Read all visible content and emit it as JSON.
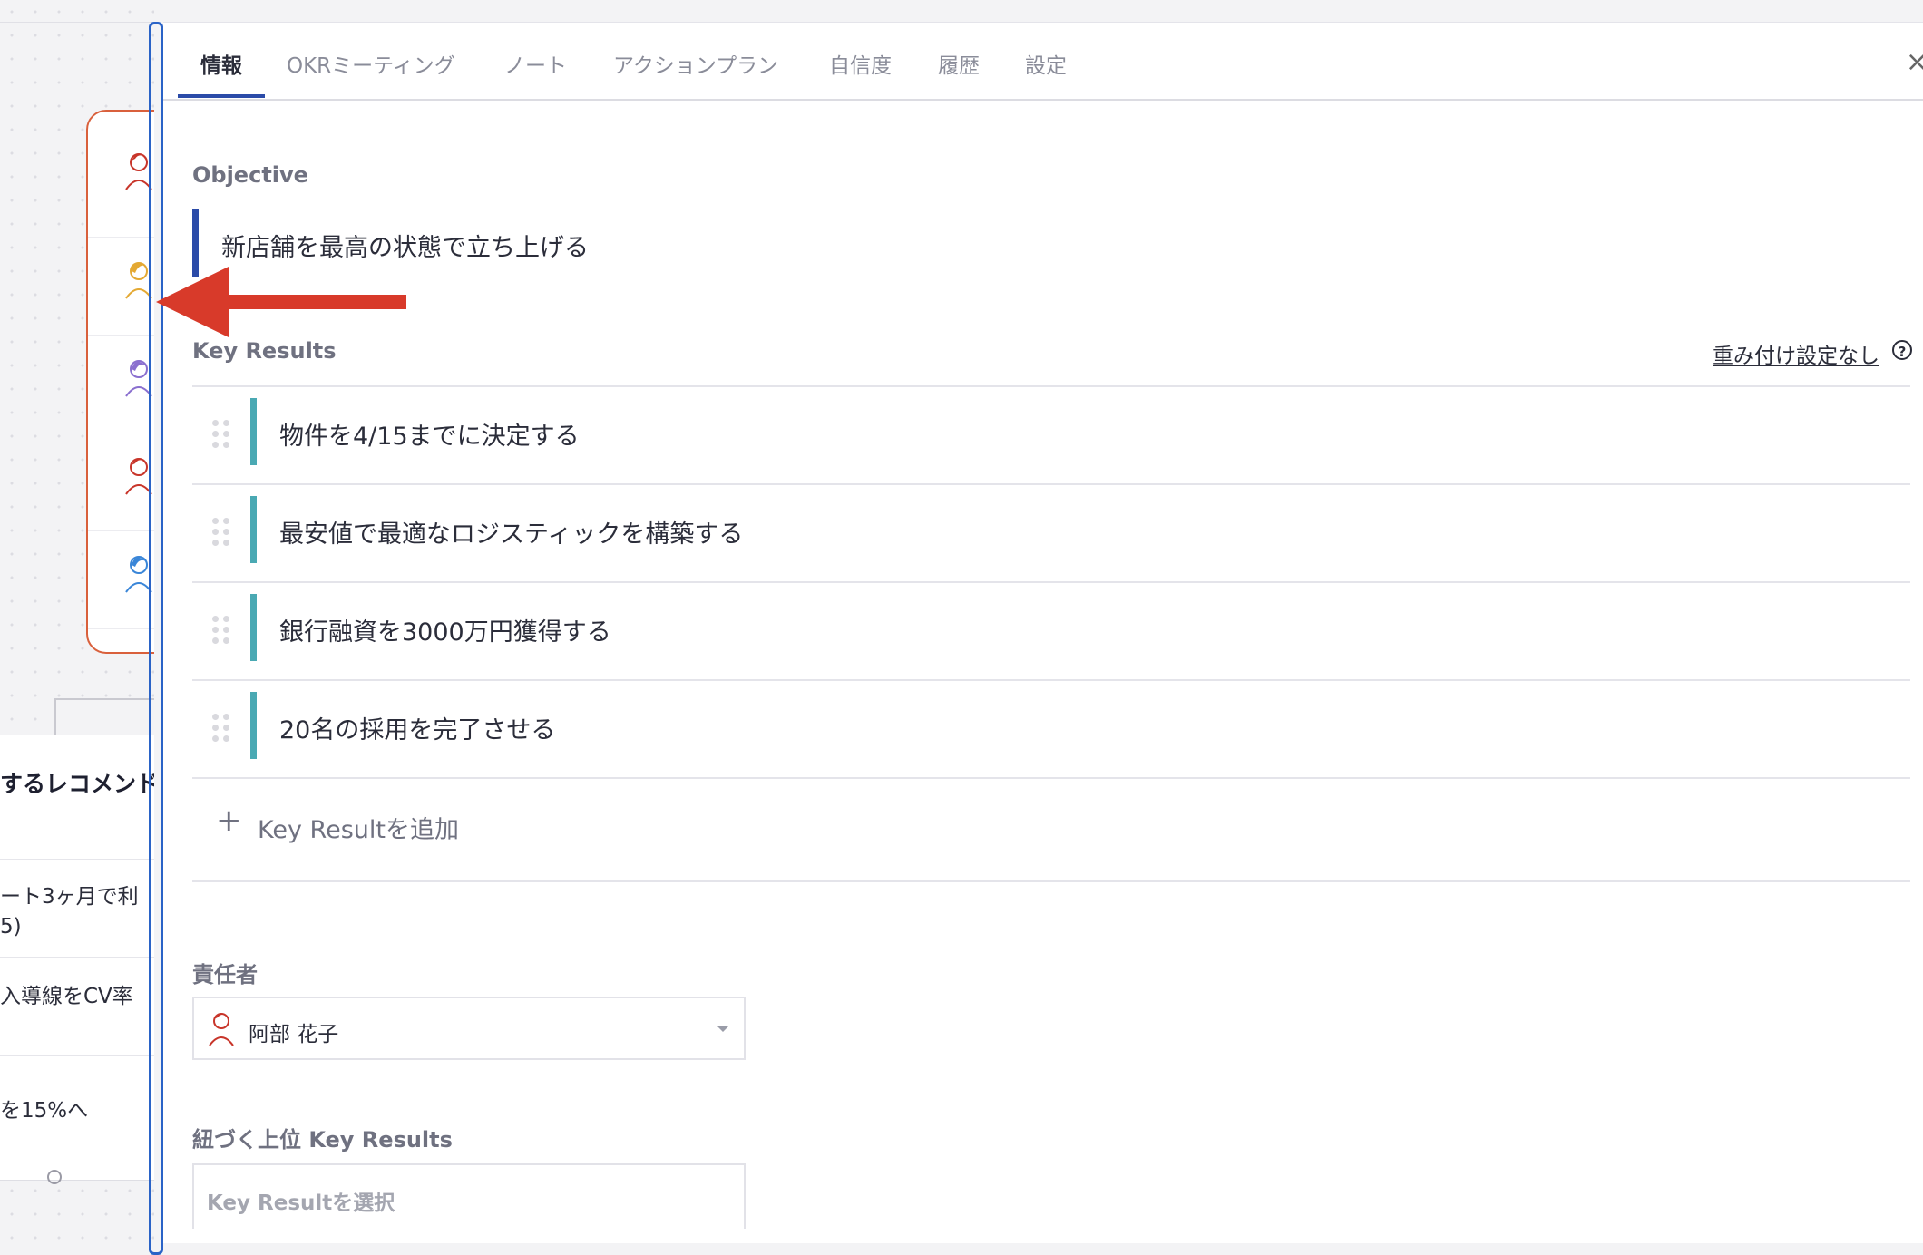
{
  "colors": {
    "accent": "#2b4ba8",
    "kr_bar": "#4aa9b3",
    "highlight_box": "#2a63c7",
    "annotation_arrow": "#d83a2a",
    "card_border": "#d9603c"
  },
  "background": {
    "recommendation_title": "するレコメンド",
    "recommendation_items": [
      {
        "line1": "ート3ヶ月で利",
        "line2": "5)"
      },
      {
        "line1": "入導線をCV率"
      },
      {
        "line1": "を15%へ"
      }
    ]
  },
  "tabs": [
    {
      "label": "情報",
      "active": true
    },
    {
      "label": "OKRミーティング"
    },
    {
      "label": "ノート"
    },
    {
      "label": "アクションプラン"
    },
    {
      "label": "自信度"
    },
    {
      "label": "履歴"
    },
    {
      "label": "設定"
    }
  ],
  "objective": {
    "label": "Objective",
    "text": "新店舗を最高の状態で立ち上げる"
  },
  "key_results": {
    "label": "Key Results",
    "weight_link": "重み付け設定なし",
    "help_icon": "?",
    "items": [
      {
        "text": "物件を4/15までに決定する"
      },
      {
        "text": "最安値で最適なロジスティックを構築する"
      },
      {
        "text": "銀行融資を3000万円獲得する"
      },
      {
        "text": "20名の採用を完了させる"
      }
    ],
    "add_plus": "+",
    "add_label": "Key Resultを追加"
  },
  "owner": {
    "label": "責任者",
    "name": "阿部 花子"
  },
  "parent_kr": {
    "label": "紐づく上位 Key Results",
    "placeholder": "Key Resultを選択"
  },
  "icons": {
    "close": "close-icon",
    "drag": "drag-handle-icon",
    "plus": "plus-icon",
    "help": "question-circle-icon",
    "caret": "caret-down-icon",
    "avatar": "user-avatar-icon"
  }
}
